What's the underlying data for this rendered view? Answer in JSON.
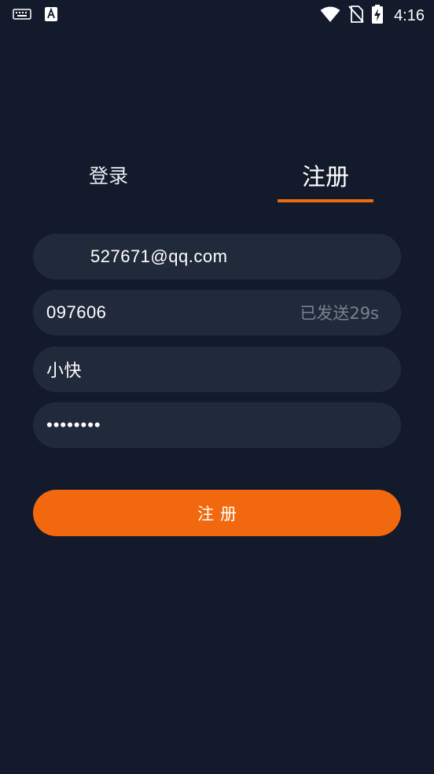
{
  "status_bar": {
    "time": "4:16",
    "icons": [
      "keyboard-icon",
      "a-text-icon",
      "wifi-icon",
      "no-sim-icon",
      "battery-charging-icon"
    ]
  },
  "tabs": [
    {
      "label": "登录",
      "active": false
    },
    {
      "label": "注册",
      "active": true
    }
  ],
  "form": {
    "email": {
      "value": "527671@qq.com"
    },
    "code": {
      "value": "097606",
      "status": "已发送29s"
    },
    "nickname": {
      "value": "小快"
    },
    "password": {
      "value": "12345678"
    },
    "submit_label": "注册"
  },
  "colors": {
    "background": "#131a2c",
    "field": "#202a3b",
    "accent": "#f2680e",
    "muted": "#7b8190"
  }
}
